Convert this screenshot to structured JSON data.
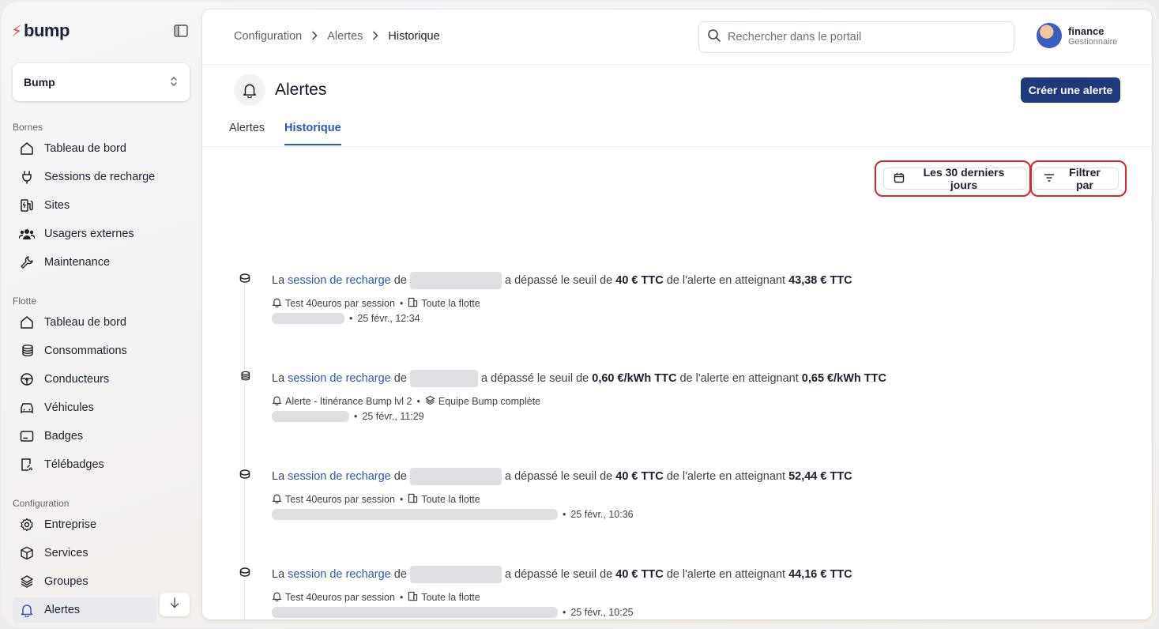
{
  "sidebar": {
    "logo": "bump",
    "org_select": "Bump",
    "sections": {
      "bornes": "Bornes",
      "flotte": "Flotte",
      "configuration": "Configuration"
    },
    "bornes_items": [
      "Tableau de bord",
      "Sessions de recharge",
      "Sites",
      "Usagers externes",
      "Maintenance"
    ],
    "flotte_items": [
      "Tableau de bord",
      "Consommations",
      "Conducteurs",
      "Véhicules",
      "Badges",
      "Télébadges"
    ],
    "config_items": [
      "Entreprise",
      "Services",
      "Groupes",
      "Alertes"
    ]
  },
  "header": {
    "breadcrumb": [
      "Configuration",
      "Alertes",
      "Historique"
    ],
    "search_placeholder": "Rechercher dans le portail",
    "user": {
      "name": "finance",
      "role": "Gestionnaire"
    }
  },
  "page": {
    "title": "Alertes",
    "create_button": "Créer une alerte",
    "tabs": [
      "Alertes",
      "Historique"
    ],
    "active_tab": "Historique",
    "date_filter": "Les 30 derniers jours",
    "filter_button": "Filtrer par"
  },
  "entries": [
    {
      "prefix": "La",
      "link": "session de recharge",
      "de": "de",
      "middle": "a dépassé le seuil de",
      "threshold": "40 € TTC",
      "suffix": "de l'alerte en atteignant",
      "value": "43,38 € TTC",
      "alert_name": "Test 40euros par session",
      "scope": "Toute la flotte",
      "time": "25 févr., 12:34"
    },
    {
      "prefix": "La",
      "link": "session de recharge",
      "de": "de",
      "middle": "a dépassé le seuil de",
      "threshold": "0,60 €/kWh TTC",
      "suffix": "de l'alerte en atteignant",
      "value": "0,65 €/kWh TTC",
      "alert_name": "Alerte - Itinérance Bump lvl 2",
      "scope": "Equipe Bump complète",
      "time": "25 févr., 11:29"
    },
    {
      "prefix": "La",
      "link": "session de recharge",
      "de": "de",
      "middle": "a dépassé le seuil de",
      "threshold": "40 € TTC",
      "suffix": "de l'alerte en atteignant",
      "value": "52,44 € TTC",
      "alert_name": "Test 40euros par session",
      "scope": "Toute la flotte",
      "time": "25 févr., 10:36"
    },
    {
      "prefix": "La",
      "link": "session de recharge",
      "de": "de",
      "middle": "a dépassé le seuil de",
      "threshold": "40 € TTC",
      "suffix": "de l'alerte en atteignant",
      "value": "44,16 € TTC",
      "alert_name": "Test 40euros par session",
      "scope": "Toute la flotte",
      "time": "25 févr., 10:25"
    }
  ],
  "colors": {
    "accent": "#2d58b8",
    "primary_button": "#1d3a7a",
    "highlight_ring": "#d9262c",
    "logo_mark": "#e5484d"
  }
}
